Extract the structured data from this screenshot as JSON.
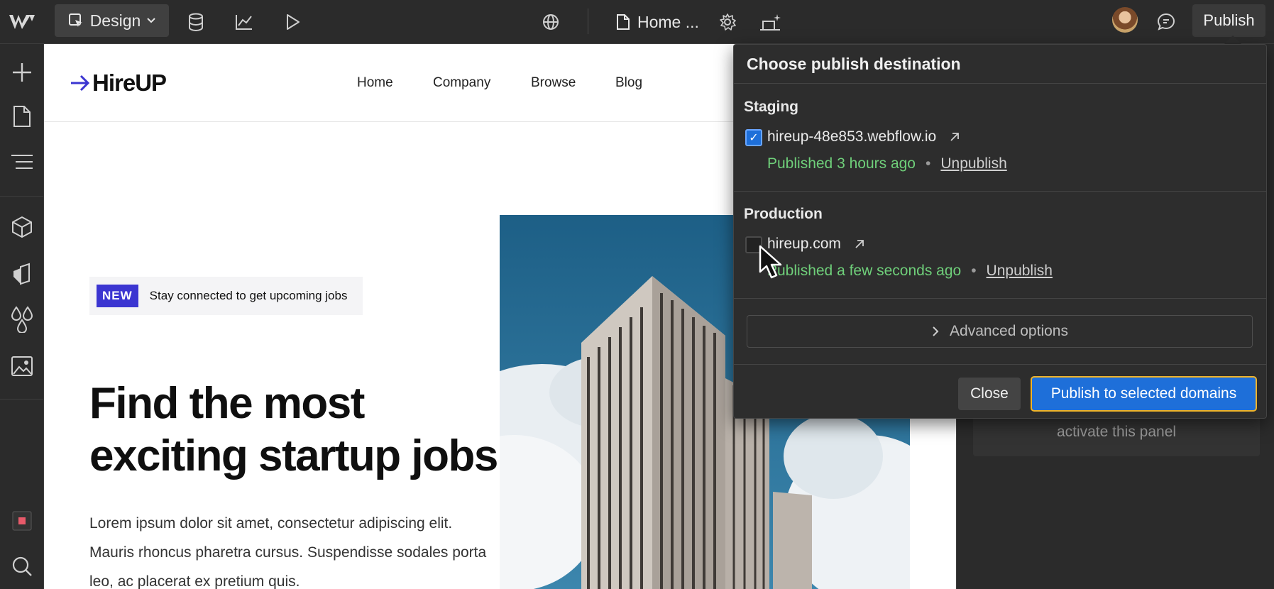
{
  "topbar": {
    "mode_label": "Design",
    "page_label": "Home ...",
    "publish_label": "Publish"
  },
  "site": {
    "brand": "HireUP",
    "nav": [
      "Home",
      "Company",
      "Browse",
      "Blog"
    ],
    "badge": "NEW",
    "badge_text": "Stay connected to get upcoming jobs",
    "hero_title_line1": "Find the most",
    "hero_title_line2": "exciting startup jobs",
    "hero_body": "Lorem ipsum dolor sit amet, consectetur adipiscing elit. Mauris rhoncus pharetra cursus. Suspendisse sodales porta leo, ac placerat ex pretium quis."
  },
  "right_panel": {
    "hint": "activate this panel"
  },
  "popup": {
    "title": "Choose publish destination",
    "staging": {
      "label": "Staging",
      "domain": "hireup-48e853.webflow.io",
      "checked": true,
      "status": "Published 3 hours ago",
      "unpublish": "Unpublish"
    },
    "production": {
      "label": "Production",
      "domain": "hireup.com",
      "checked": false,
      "status": "Published a few seconds ago",
      "unpublish": "Unpublish"
    },
    "advanced": "Advanced options",
    "close": "Close",
    "publish_selected": "Publish to selected domains"
  },
  "colors": {
    "accent_blue": "#1e6fd9",
    "status_green": "#6fcf7a",
    "brand_blue": "#3b35d1",
    "focus_ring": "#f0b429"
  }
}
